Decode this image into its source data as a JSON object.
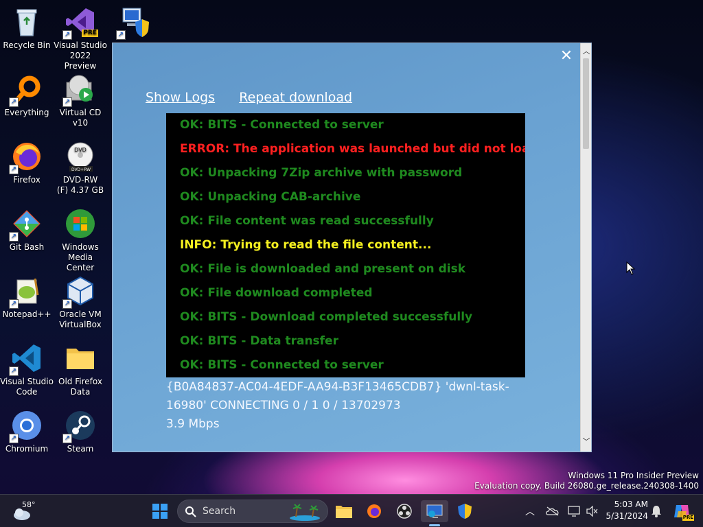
{
  "desktop": {
    "icons": [
      {
        "label": "Recycle Bin"
      },
      {
        "label": "Visual Studio 2022 Preview",
        "badge": "PRE"
      },
      {
        "label": ""
      },
      {
        "label": "Everything"
      },
      {
        "label": "Virtual CD v10"
      },
      {
        "label": "Firefox"
      },
      {
        "label": "DVD-RW (F) 4.37 GB",
        "disc_label": "DVD",
        "disc_sub": "DVD+RW"
      },
      {
        "label": "Git Bash"
      },
      {
        "label": "Windows Media Center"
      },
      {
        "label": "Notepad++"
      },
      {
        "label": "Oracle VM VirtualBox"
      },
      {
        "label": "Visual Studio Code"
      },
      {
        "label": "Old Firefox Data"
      },
      {
        "label": "Chromium"
      },
      {
        "label": "Steam"
      }
    ]
  },
  "dialog": {
    "close_glyph": "✕",
    "links": {
      "show_logs": "Show Logs",
      "repeat_download": "Repeat download"
    },
    "log_lines": [
      {
        "text": "OK: BITS - Connected to server",
        "color": "#1f8a1f"
      },
      {
        "text": "ERROR: The application was launched but did not load",
        "color": "#ff2020"
      },
      {
        "text": "OK: Unpacking 7Zip archive with password",
        "color": "#1f8a1f"
      },
      {
        "text": "OK: Unpacking CAB-archive",
        "color": "#1f8a1f"
      },
      {
        "text": "OK: File content was read successfully",
        "color": "#1f8a1f"
      },
      {
        "text": "INFO: Trying to read the file content...",
        "color": "#f5f020"
      },
      {
        "text": "OK: File is downloaded and present on disk",
        "color": "#1f8a1f"
      },
      {
        "text": "OK: File download completed",
        "color": "#1f8a1f"
      },
      {
        "text": "OK: BITS - Download completed successfully",
        "color": "#1f8a1f"
      },
      {
        "text": "OK: BITS - Data transfer",
        "color": "#1f8a1f"
      },
      {
        "text": "OK: BITS - Connected to server",
        "color": "#1f8a1f"
      }
    ],
    "status_line1": "{B0A84837-AC04-4EDF-AA94-B3F13465CDB7} 'dwnl-task-",
    "status_line2": "16980' CONNECTING 0 / 1 0 / 13702973",
    "status_line3": "3.9 Mbps"
  },
  "watermark": {
    "line1": "Windows 11 Pro Insider Preview",
    "line2": "Evaluation copy. Build 26080.ge_release.240308-1400"
  },
  "taskbar": {
    "weather_temp": "58°",
    "search_label": "Search",
    "clock_time": "5:03 AM",
    "clock_date": "5/31/2024",
    "copilot_badge": "PRE"
  }
}
